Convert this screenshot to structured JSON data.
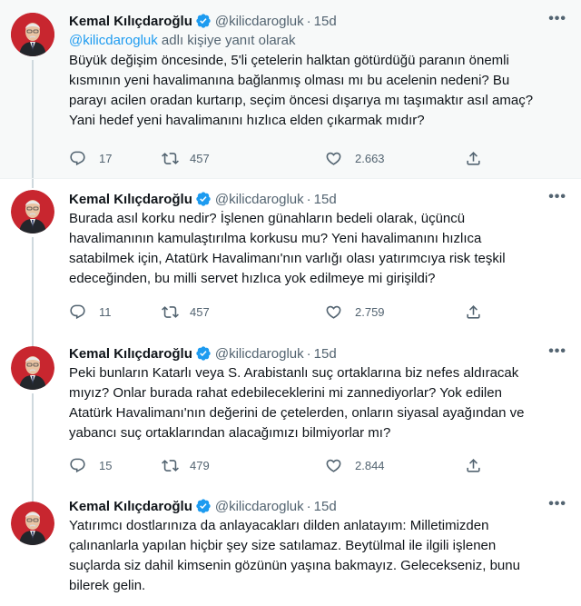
{
  "tweets": [
    {
      "name": "Kemal Kılıçdaroğlu",
      "handle": "@kilicdarogluk",
      "separator": "·",
      "time": "15d",
      "reply_prefix": "@kilicdarogluk",
      "reply_suffix": " adlı kişiye yanıt olarak",
      "lines": [
        "Büyük değişim öncesinde, 5'li çetelerin halktan götürdüğü paranın önemli",
        "kısmının yeni havalimanına bağlanmış olması mı bu acelenin nedeni? Bu",
        "parayı acilen oradan kurtarıp, seçim öncesi dışarıya mı taşımaktır asıl amaç?",
        "Yani hedef yeni havalimanını hızlıca elden çıkarmak mıdır?"
      ],
      "replies": "17",
      "retweets": "457",
      "likes": "2.663"
    },
    {
      "name": "Kemal Kılıçdaroğlu",
      "handle": "@kilicdarogluk",
      "separator": "·",
      "time": "15d",
      "lines": [
        "Burada asıl korku nedir? İşlenen günahların bedeli olarak, üçüncü",
        "havalimanının kamulaştırılma korkusu mu? Yeni havalimanını hızlıca",
        "satabilmek için, Atatürk Havalimanı'nın varlığı olası yatırımcıya risk teşkil",
        "edeceğinden, bu milli servet hızlıca yok edilmeye mi girişildi?"
      ],
      "replies": "11",
      "retweets": "457",
      "likes": "2.759"
    },
    {
      "name": "Kemal Kılıçdaroğlu",
      "handle": "@kilicdarogluk",
      "separator": "·",
      "time": "15d",
      "lines": [
        "Peki bunların Katarlı veya S. Arabistanlı suç ortaklarına biz nefes aldıracak",
        "mıyız? Onlar burada rahat edebileceklerini mi zannediyorlar? Yok edilen",
        "Atatürk Havalimanı'nın değerini de çetelerden, onların siyasal ayağından ve",
        "yabancı suç ortaklarından alacağımızı bilmiyorlar mı?"
      ],
      "replies": "15",
      "retweets": "479",
      "likes": "2.844"
    },
    {
      "name": "Kemal Kılıçdaroğlu",
      "handle": "@kilicdarogluk",
      "separator": "·",
      "time": "15d",
      "lines": [
        "Yatırımcı dostlarınıza da anlayacakları dilden anlatayım: Milletimizden",
        "çalınanlarla yapılan hiçbir şey size satılamaz. Beytülmal ile ilgili işlenen",
        "suçlarda siz dahil kimsenin gözünün yaşına bakmayız. Gelecekseniz, bunu",
        "bilerek gelin."
      ]
    }
  ],
  "more_label": "•••",
  "icons": {
    "avatar": "avatar-photo",
    "verified": "verified-badge-icon",
    "reply": "reply-icon",
    "retweet": "retweet-icon",
    "like": "heart-icon",
    "share": "share-icon",
    "more": "more-icon"
  },
  "colors": {
    "accent": "#1d9bf0",
    "secondary_text": "#536471",
    "highlight_background": "#f7f9f9",
    "thread_line": "#cfd9de"
  }
}
